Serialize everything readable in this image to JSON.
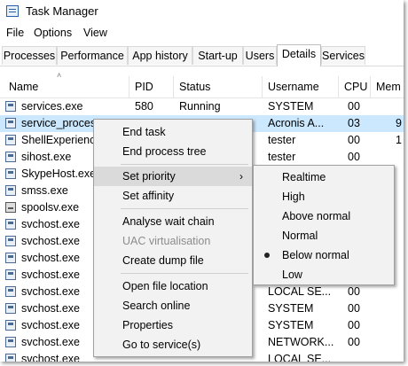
{
  "window": {
    "title": "Task Manager"
  },
  "menubar": [
    "File",
    "Options",
    "View"
  ],
  "tabs": [
    "Processes",
    "Performance",
    "App history",
    "Start-up",
    "Users",
    "Details",
    "Services"
  ],
  "active_tab": "Details",
  "columns": [
    "Name",
    "PID",
    "Status",
    "Username",
    "CPU",
    "Mem"
  ],
  "rows": [
    {
      "name": "services.exe",
      "pid": "580",
      "status": "Running",
      "user": "SYSTEM",
      "cpu": "00",
      "mem": ""
    },
    {
      "name": "service_process",
      "pid": "",
      "status": "",
      "user": "Acronis A...",
      "cpu": "03",
      "mem": "9"
    },
    {
      "name": "ShellExperience",
      "pid": "",
      "status": "",
      "user": "tester",
      "cpu": "00",
      "mem": "1"
    },
    {
      "name": "sihost.exe",
      "pid": "",
      "status": "",
      "user": "tester",
      "cpu": "00",
      "mem": ""
    },
    {
      "name": "SkypeHost.exe",
      "pid": "",
      "status": "",
      "user": "",
      "cpu": "",
      "mem": ""
    },
    {
      "name": "smss.exe",
      "pid": "",
      "status": "",
      "user": "",
      "cpu": "",
      "mem": ""
    },
    {
      "name": "spoolsv.exe",
      "pid": "",
      "status": "",
      "user": "",
      "cpu": "",
      "mem": ""
    },
    {
      "name": "svchost.exe",
      "pid": "",
      "status": "",
      "user": "",
      "cpu": "",
      "mem": ""
    },
    {
      "name": "svchost.exe",
      "pid": "",
      "status": "",
      "user": "",
      "cpu": "",
      "mem": ""
    },
    {
      "name": "svchost.exe",
      "pid": "",
      "status": "",
      "user": "",
      "cpu": "",
      "mem": ""
    },
    {
      "name": "svchost.exe",
      "pid": "",
      "status": "",
      "user": "",
      "cpu": "",
      "mem": ""
    },
    {
      "name": "svchost.exe",
      "pid": "",
      "status": "",
      "user": "LOCAL SE...",
      "cpu": "00",
      "mem": ""
    },
    {
      "name": "svchost.exe",
      "pid": "",
      "status": "",
      "user": "SYSTEM",
      "cpu": "00",
      "mem": ""
    },
    {
      "name": "svchost.exe",
      "pid": "",
      "status": "",
      "user": "SYSTEM",
      "cpu": "00",
      "mem": ""
    },
    {
      "name": "svchost.exe",
      "pid": "",
      "status": "",
      "user": "NETWORK...",
      "cpu": "00",
      "mem": ""
    },
    {
      "name": "svchost.exe",
      "pid": "",
      "status": "",
      "user": "LOCAL SE...",
      "cpu": "",
      "mem": ""
    }
  ],
  "context_menu": [
    "End task",
    "End process tree",
    "Set priority",
    "Set affinity",
    "Analyse wait chain",
    "UAC virtualisation",
    "Create dump file",
    "Open file location",
    "Search online",
    "Properties",
    "Go to service(s)"
  ],
  "priority_menu": [
    "Realtime",
    "High",
    "Above normal",
    "Normal",
    "Below normal",
    "Low"
  ],
  "priority_selected": "Below normal",
  "icons": {
    "app": "task-manager-icon",
    "sort": "sort-up-arrow-icon",
    "submenu": "chevron-right-icon",
    "selected_priority": "radio-dot-icon"
  },
  "colors": {
    "selection": "#cce8ff",
    "menu_bg": "#f2f2f2",
    "menu_hover": "#dadada"
  }
}
